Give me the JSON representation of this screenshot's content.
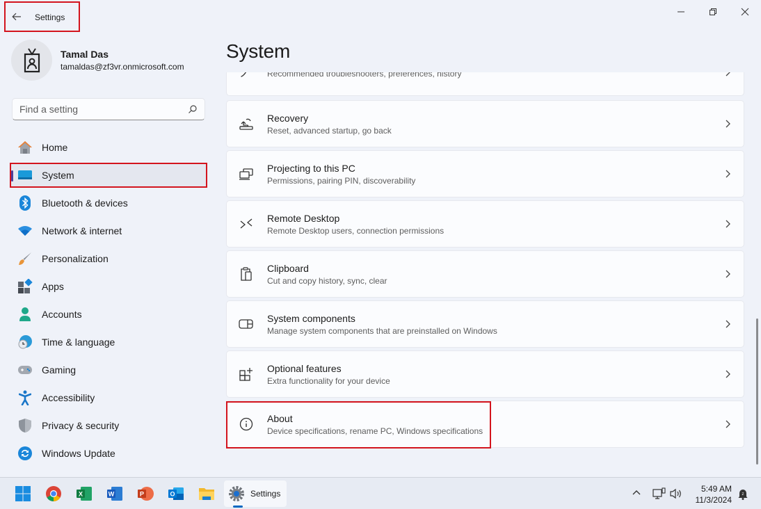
{
  "window": {
    "app_title": "Settings",
    "controls": {
      "minimize": "minimize-icon",
      "restore": "restore-icon",
      "close": "close-icon"
    }
  },
  "profile": {
    "name": "Tamal Das",
    "email": "tamaldas@zf3vr.onmicrosoft.com"
  },
  "search": {
    "placeholder": "Find a setting",
    "value": ""
  },
  "sidebar": {
    "items": [
      {
        "label": "Home",
        "icon": "home-icon",
        "selected": false
      },
      {
        "label": "System",
        "icon": "system-icon",
        "selected": true
      },
      {
        "label": "Bluetooth & devices",
        "icon": "bluetooth-icon",
        "selected": false
      },
      {
        "label": "Network & internet",
        "icon": "wifi-icon",
        "selected": false
      },
      {
        "label": "Personalization",
        "icon": "brush-icon",
        "selected": false
      },
      {
        "label": "Apps",
        "icon": "apps-icon",
        "selected": false
      },
      {
        "label": "Accounts",
        "icon": "person-icon",
        "selected": false
      },
      {
        "label": "Time & language",
        "icon": "clock-globe-icon",
        "selected": false
      },
      {
        "label": "Gaming",
        "icon": "gamepad-icon",
        "selected": false
      },
      {
        "label": "Accessibility",
        "icon": "accessibility-icon",
        "selected": false
      },
      {
        "label": "Privacy & security",
        "icon": "shield-icon",
        "selected": false
      },
      {
        "label": "Windows Update",
        "icon": "update-icon",
        "selected": false
      }
    ]
  },
  "main": {
    "title": "System",
    "cards": [
      {
        "title": "",
        "subtitle": "Recommended troubleshooters, preferences, history",
        "icon": "wrench-icon"
      },
      {
        "title": "Recovery",
        "subtitle": "Reset, advanced startup, go back",
        "icon": "recovery-icon"
      },
      {
        "title": "Projecting to this PC",
        "subtitle": "Permissions, pairing PIN, discoverability",
        "icon": "projecting-icon"
      },
      {
        "title": "Remote Desktop",
        "subtitle": "Remote Desktop users, connection permissions",
        "icon": "remote-desktop-icon"
      },
      {
        "title": "Clipboard",
        "subtitle": "Cut and copy history, sync, clear",
        "icon": "clipboard-icon"
      },
      {
        "title": "System components",
        "subtitle": "Manage system components that are preinstalled on Windows",
        "icon": "system-components-icon"
      },
      {
        "title": "Optional features",
        "subtitle": "Extra functionality for your device",
        "icon": "optional-features-icon"
      },
      {
        "title": "About",
        "subtitle": "Device specifications, rename PC, Windows specifications",
        "icon": "info-icon"
      }
    ]
  },
  "taskbar": {
    "apps": [
      {
        "name": "Start",
        "icon": "windows-start-icon"
      },
      {
        "name": "Google Chrome",
        "icon": "chrome-icon"
      },
      {
        "name": "Excel",
        "icon": "excel-icon"
      },
      {
        "name": "Word",
        "icon": "word-icon"
      },
      {
        "name": "PowerPoint",
        "icon": "powerpoint-icon"
      },
      {
        "name": "Outlook",
        "icon": "outlook-icon"
      },
      {
        "name": "File Explorer",
        "icon": "folder-icon"
      }
    ],
    "active_app_label": "Settings",
    "time": "5:49 AM",
    "date": "11/3/2024"
  },
  "colors": {
    "highlight": "#d3141d",
    "accent": "#0067c0",
    "background": "#eff2f9",
    "card": "#fbfcfe"
  }
}
